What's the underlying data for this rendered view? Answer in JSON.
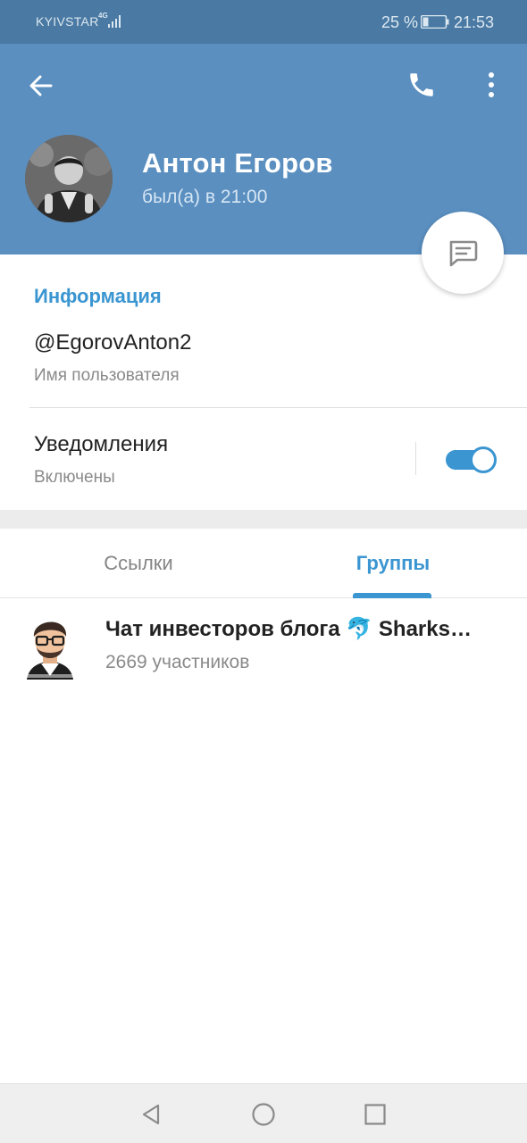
{
  "status_bar": {
    "carrier": "KYIVSTAR",
    "network": "4G",
    "battery_percent": "25 %",
    "battery_level": 0.25,
    "time": "21:53"
  },
  "header": {
    "back_icon": "arrow-left-icon",
    "call_icon": "phone-icon",
    "more_icon": "more-vertical-icon",
    "name": "Антон Егоров",
    "status": "был(а) в 21:00",
    "fab_icon": "message-icon"
  },
  "info": {
    "title": "Информация",
    "username": "@EgorovAnton2",
    "username_label": "Имя пользователя",
    "notifications_label": "Уведомления",
    "notifications_value": "Включены",
    "notifications_enabled": true
  },
  "tabs": [
    {
      "label": "Ссылки",
      "active": false
    },
    {
      "label": "Группы",
      "active": true
    }
  ],
  "groups": [
    {
      "name": "Чат инвесторов блога 🐬 Sharks…",
      "members": "2669 участников"
    }
  ],
  "colors": {
    "header": "#5a8fc0",
    "status_bar": "#4a7aa3",
    "accent": "#3a95d1"
  }
}
